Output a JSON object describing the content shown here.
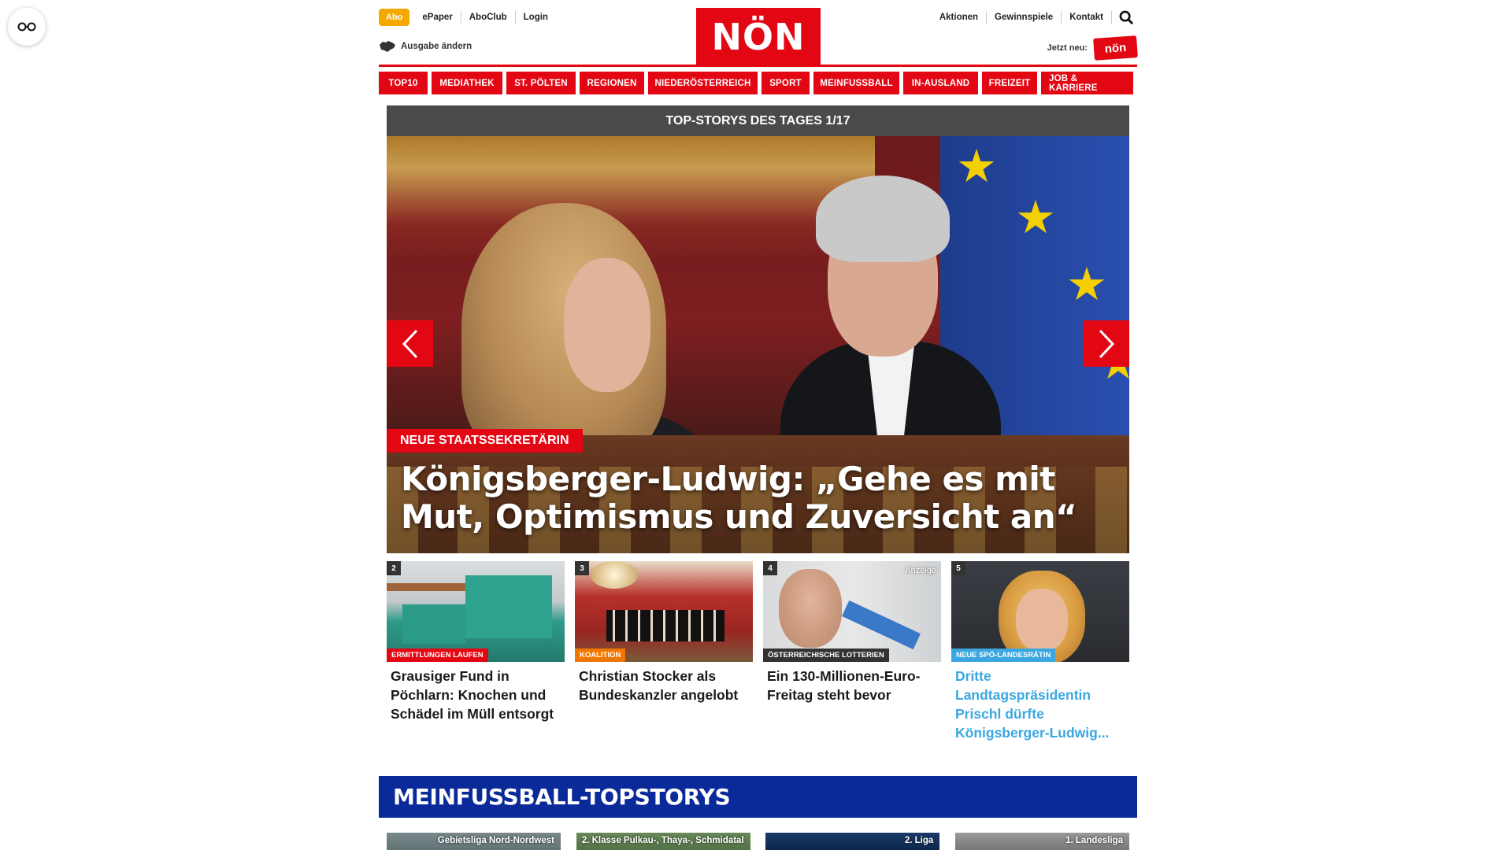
{
  "side_button": {
    "icon": "glasses-icon"
  },
  "header": {
    "abo": "Abo",
    "left_links": [
      "ePaper",
      "AboClub",
      "Login"
    ],
    "ausgabe": "Ausgabe ändern",
    "logo": "NÖN",
    "right_links": [
      "Aktionen",
      "Gewinnspiele",
      "Kontakt"
    ],
    "jetzt_label": "Jetzt neu:",
    "jetzt_badge": "nön",
    "brand_color": "#e30613"
  },
  "nav": [
    "TOP10",
    "MEDIATHEK",
    "ST. PÖLTEN",
    "REGIONEN",
    "NIEDERÖSTERREICH",
    "SPORT",
    "MEINFUSSBALL",
    "IN-AUSLAND",
    "FREIZEIT",
    "JOB & KARRIERE"
  ],
  "hero": {
    "heading": "TOP-STORYS DES TAGES 1/17",
    "kicker": "NEUE STAATSSEKRETÄRIN",
    "title": "Königsberger-Ludwig: „Gehe es mit Mut, Optimismus und Zuversicht an“"
  },
  "cards": [
    {
      "num": "2",
      "kicker": "ERMITTLUNGEN LAUFEN",
      "kicker_color": "#e30613",
      "title": "Grausiger Fund in Pöchlarn: Knochen und Schädel im Müll entsorgt",
      "anzeige": "",
      "blue": false
    },
    {
      "num": "3",
      "kicker": "KOALITION",
      "kicker_color": "#f07800",
      "title": "Christian Stocker als Bundeskanzler angelobt",
      "anzeige": "",
      "blue": false
    },
    {
      "num": "4",
      "kicker": "ÖSTERREICHISCHE LOTTERIEN",
      "kicker_color": "#333333",
      "title": "Ein 130-Millionen-Euro-Freitag steht bevor",
      "anzeige": "Anzeige",
      "blue": false
    },
    {
      "num": "5",
      "kicker": "NEUE SPÖ-LANDESRÄTIN",
      "kicker_color": "#3aa7e0",
      "title": "Dritte Landtagspräsidentin Prischl dürfte Königsberger-Ludwig...",
      "anzeige": "",
      "blue": true
    }
  ],
  "football": {
    "heading": "MEINFUSSBALL-TOPSTORYS",
    "labels": [
      "Gebietsliga Nord-Nordwest",
      "2. Klasse Pulkau-, Thaya-, Schmidatal",
      "2. Liga",
      "1. Landesliga"
    ]
  }
}
